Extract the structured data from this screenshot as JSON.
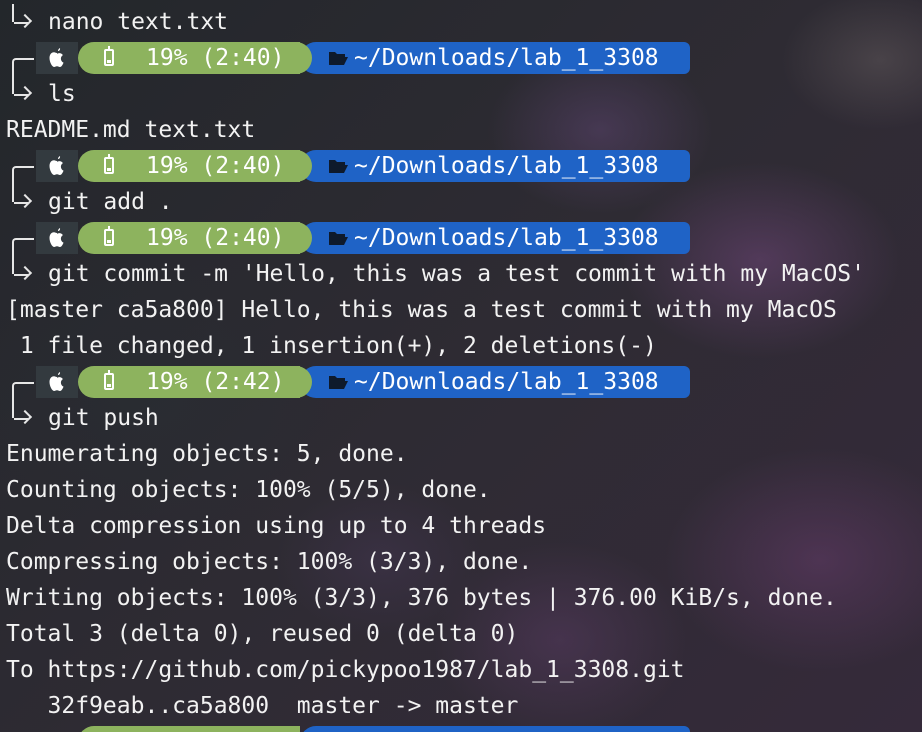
{
  "prompt": {
    "battery": "19% (2:40)",
    "battery_later": "19% (2:42)",
    "path": "~/Downloads/lab_1_3308",
    "os_icon": "apple-icon",
    "battery_icon": "battery-icon",
    "folder_icon": "folder-open-icon",
    "colors": {
      "os_segment": "#333a3f",
      "battery_segment": "#8db35e",
      "path_segment": "#1f63c6"
    }
  },
  "commands": {
    "nano": "nano text.txt",
    "ls": "ls",
    "git_add": "git add .",
    "git_commit": "git commit -m 'Hello, this was a test commit with my MacOS'",
    "git_push": "git push"
  },
  "output": {
    "ls_result": "README.md text.txt",
    "commit_line1": "[master ca5a800] Hello, this was a test commit with my MacOS",
    "commit_line2": " 1 file changed, 1 insertion(+), 2 deletions(-)",
    "push_lines": [
      "Enumerating objects: 5, done.",
      "Counting objects: 100% (5/5), done.",
      "Delta compression using up to 4 threads",
      "Compressing objects: 100% (3/3), done.",
      "Writing objects: 100% (3/3), 376 bytes | 376.00 KiB/s, done.",
      "Total 3 (delta 0), reused 0 (delta 0)",
      "To https://github.com/pickypoo1987/lab_1_3308.git",
      "   32f9eab..ca5a800  master -> master"
    ]
  }
}
